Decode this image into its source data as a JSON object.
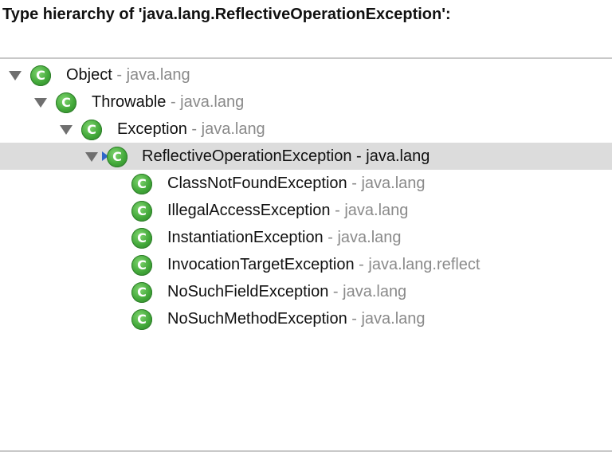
{
  "header": {
    "title": "Type hierarchy of 'java.lang.ReflectiveOperationException':"
  },
  "tree": {
    "separator": " - ",
    "nodes": [
      {
        "name": "Object",
        "package": "java.lang",
        "expanded": true,
        "icon": "class-icon"
      },
      {
        "name": "Throwable",
        "package": "java.lang",
        "expanded": true,
        "icon": "class-icon"
      },
      {
        "name": "Exception",
        "package": "java.lang",
        "expanded": true,
        "icon": "class-icon"
      },
      {
        "name": "ReflectiveOperationException",
        "package": "java.lang",
        "expanded": true,
        "selected": true,
        "icon": "focus-class-icon"
      },
      {
        "name": "ClassNotFoundException",
        "package": "java.lang",
        "icon": "class-icon"
      },
      {
        "name": "IllegalAccessException",
        "package": "java.lang",
        "icon": "class-icon"
      },
      {
        "name": "InstantiationException",
        "package": "java.lang",
        "icon": "class-icon"
      },
      {
        "name": "InvocationTargetException",
        "package": "java.lang.reflect",
        "icon": "class-icon"
      },
      {
        "name": "NoSuchFieldException",
        "package": "java.lang",
        "icon": "class-icon"
      },
      {
        "name": "NoSuchMethodException",
        "package": "java.lang",
        "icon": "class-icon"
      }
    ]
  },
  "colors": {
    "selection": "#dcdcdc",
    "package_text": "#8a8a8a",
    "class_icon": "#42a839",
    "focus_marker": "#2f67c9"
  }
}
